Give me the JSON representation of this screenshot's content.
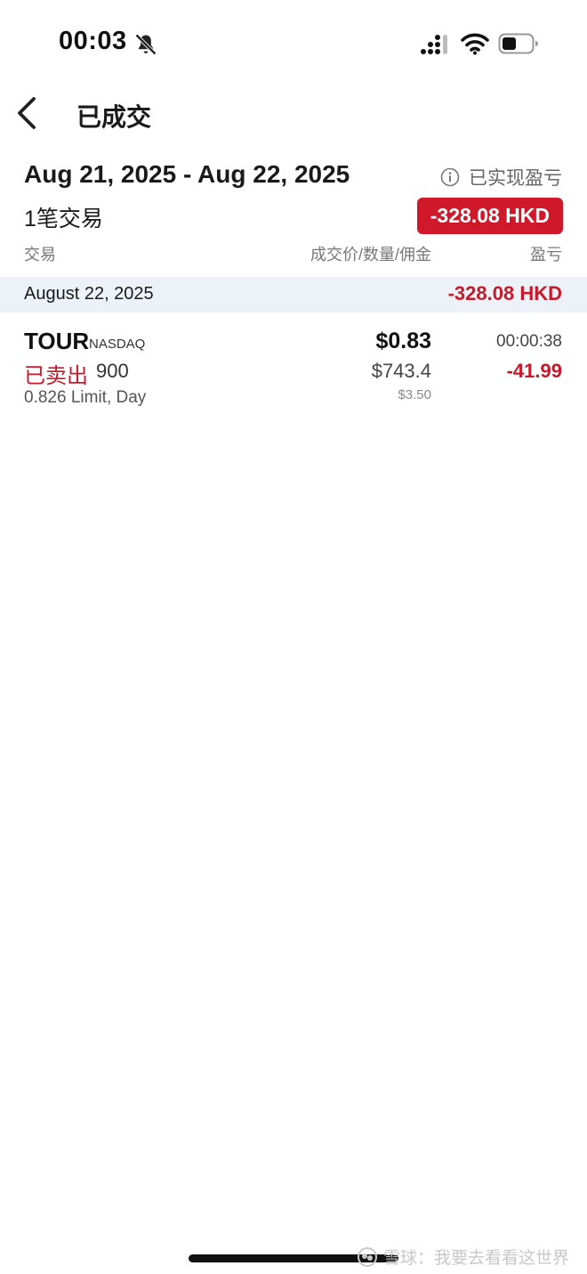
{
  "status_bar": {
    "time": "00:03",
    "icons": [
      "bell-slash-icon",
      "signal-icon",
      "wifi-icon",
      "battery-icon"
    ]
  },
  "nav": {
    "back_icon": "chevron-left-icon",
    "title": "已成交"
  },
  "summary": {
    "date_range": "Aug 21, 2025 - Aug 22, 2025",
    "trade_count": "1笔交易",
    "realized_label": "已实现盈亏",
    "total_pnl": "-328.08 HKD"
  },
  "columns": {
    "trade": "交易",
    "price_qty_commission": "成交价/数量/佣金",
    "pnl": "盈亏"
  },
  "groups": [
    {
      "date": "August 22, 2025",
      "pnl": "-328.08 HKD",
      "trades": [
        {
          "ticker": "TOUR",
          "exchange": "NASDAQ",
          "side": "已卖出",
          "quantity": "900",
          "order_desc": "0.826 Limit, Day",
          "fill_price": "$0.83",
          "amount": "$743.4",
          "commission": "$3.50",
          "time": "00:00:38",
          "pnl": "-41.99"
        }
      ]
    }
  ],
  "watermark": "雪球：我要去看看这世界",
  "colors": {
    "loss_red": "#c8192b",
    "badge_red": "#d0182b",
    "group_band": "#edf2f9"
  }
}
